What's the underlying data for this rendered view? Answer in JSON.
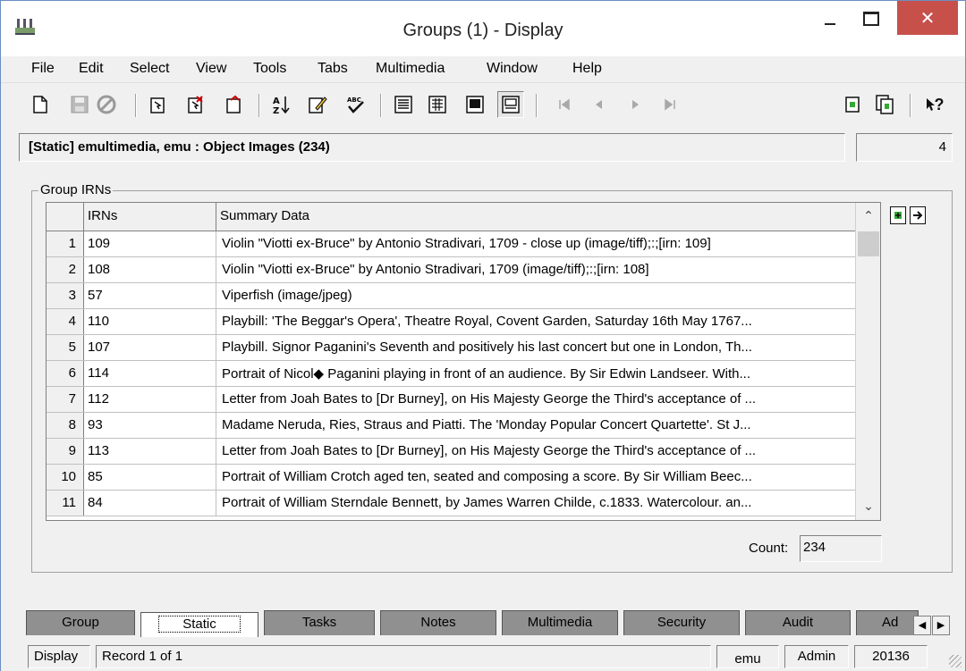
{
  "window": {
    "title": "Groups (1) - Display",
    "close_glyph": "✕"
  },
  "menu": [
    "File",
    "Edit",
    "Select",
    "View",
    "Tools",
    "Tabs",
    "Multimedia",
    "Window",
    "Help"
  ],
  "toolbar": {
    "help_glyph": "?"
  },
  "context": {
    "label": "[Static] emultimedia,  emu : Object Images (234)",
    "count": "4"
  },
  "group": {
    "label": "Group IRNs",
    "columns": [
      "IRNs",
      "Summary Data"
    ],
    "rows": [
      {
        "num": "1",
        "irn": "109",
        "summary": "Violin \"Viotti ex-Bruce\" by Antonio Stradivari, 1709 - close up (image/tiff);:;[irn: 109]"
      },
      {
        "num": "2",
        "irn": "108",
        "summary": "Violin \"Viotti ex-Bruce\" by Antonio Stradivari, 1709 (image/tiff);:;[irn: 108]"
      },
      {
        "num": "3",
        "irn": "57",
        "summary": "Viperfish (image/jpeg)"
      },
      {
        "num": "4",
        "irn": "110",
        "summary": "Playbill:  'The Beggar's Opera', Theatre Royal, Covent Garden, Saturday 16th May 1767..."
      },
      {
        "num": "5",
        "irn": "107",
        "summary": "Playbill.  Signor Paganini's Seventh and positively his last concert but one in London, Th..."
      },
      {
        "num": "6",
        "irn": "114",
        "summary": "Portrait of Nicol◆ Paganini playing in front of an audience.  By Sir Edwin Landseer. With..."
      },
      {
        "num": "7",
        "irn": "112",
        "summary": "Letter from Joah Bates to [Dr Burney], on His Majesty George the Third's acceptance of ..."
      },
      {
        "num": "8",
        "irn": "93",
        "summary": "Madame Neruda, Ries, Straus and Piatti.  The 'Monday Popular Concert Quartette'.  St J..."
      },
      {
        "num": "9",
        "irn": "113",
        "summary": "Letter from Joah Bates to [Dr Burney], on His Majesty George the Third's acceptance of ..."
      },
      {
        "num": "10",
        "irn": "85",
        "summary": "Portrait of William Crotch aged ten, seated and composing a score.  By Sir William Beec..."
      },
      {
        "num": "11",
        "irn": "84",
        "summary": "Portrait of William Sterndale Bennett, by James Warren Childe, c.1833.  Watercolour. an..."
      }
    ],
    "count_label": "Count:",
    "count_value": "234"
  },
  "tabs": [
    "Group",
    "Static",
    "Tasks",
    "Notes",
    "Multimedia",
    "Security",
    "Audit",
    "Ad"
  ],
  "active_tab": "Static",
  "status": {
    "mode": "Display",
    "record": "Record 1 of 1",
    "user": "emu",
    "group": "Admin",
    "id": "20136"
  }
}
